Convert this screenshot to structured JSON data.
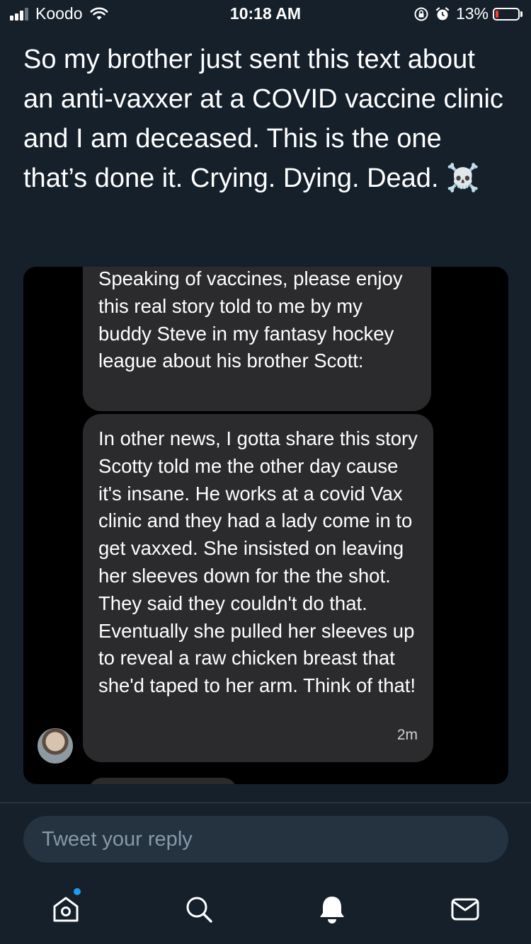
{
  "status_bar": {
    "carrier": "Koodo",
    "time": "10:18 AM",
    "battery_percent": "13%",
    "battery_level": 0.13,
    "icons": [
      "signal-icon",
      "wifi-icon",
      "orientation-lock-icon",
      "alarm-icon",
      "battery-icon"
    ]
  },
  "tweet": {
    "text": "So my brother just sent this text about an anti-vaxxer at a COVID vaccine clinic and I am deceased. This is the one that’s done it. Crying. Dying. Dead. ☠️"
  },
  "media": {
    "messages": [
      {
        "text": "Speaking of vaccines, please enjoy this real story told to me by my buddy Steve in my fantasy hockey league about his brother Scott:"
      },
      {
        "text": "In other news, I gotta share this story Scotty told me the other day cause it's insane. He works at a covid Vax clinic and they had a lady come in to get vaxxed. She insisted on leaving her sleeves down for the the shot. They said they couldn't do that. Eventually she pulled her sleeves up to reveal a raw chicken breast that she'd taped to her arm. Think of that!",
        "time": "2m"
      }
    ]
  },
  "reply": {
    "placeholder": "Tweet your reply"
  },
  "tab_bar": {
    "tabs": [
      "home-icon",
      "search-icon",
      "notifications-icon",
      "messages-icon"
    ],
    "accent_color": "#1d9bf0"
  },
  "colors": {
    "background": "#15202b",
    "reply_box": "#253341",
    "placeholder": "#8899a6",
    "bubble": "#2b2b2d"
  }
}
